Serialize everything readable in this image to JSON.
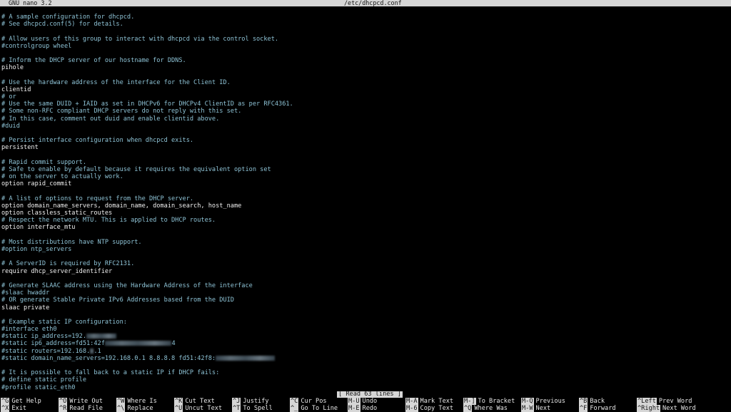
{
  "titlebar": {
    "app": "GNU nano 3.2",
    "file": "/etc/dhcpcd.conf"
  },
  "lines": [
    {
      "t": "# A sample configuration for dhcpcd.",
      "k": "comment"
    },
    {
      "t": "# See dhcpcd.conf(5) for details.",
      "k": "comment"
    },
    {
      "t": "",
      "k": "blank"
    },
    {
      "t": "# Allow users of this group to interact with dhcpcd via the control socket.",
      "k": "comment"
    },
    {
      "t": "#controlgroup wheel",
      "k": "comment"
    },
    {
      "t": "",
      "k": "blank"
    },
    {
      "t": "# Inform the DHCP server of our hostname for DDNS.",
      "k": "comment"
    },
    {
      "t": "pihole",
      "k": "code"
    },
    {
      "t": "",
      "k": "blank"
    },
    {
      "t": "# Use the hardware address of the interface for the Client ID.",
      "k": "comment"
    },
    {
      "t": "clientid",
      "k": "code"
    },
    {
      "t": "# or",
      "k": "comment"
    },
    {
      "t": "# Use the same DUID + IAID as set in DHCPv6 for DHCPv4 ClientID as per RFC4361.",
      "k": "comment"
    },
    {
      "t": "# Some non-RFC compliant DHCP servers do not reply with this set.",
      "k": "comment"
    },
    {
      "t": "# In this case, comment out duid and enable clientid above.",
      "k": "comment"
    },
    {
      "t": "#duid",
      "k": "comment"
    },
    {
      "t": "",
      "k": "blank"
    },
    {
      "t": "# Persist interface configuration when dhcpcd exits.",
      "k": "comment"
    },
    {
      "t": "persistent",
      "k": "code"
    },
    {
      "t": "",
      "k": "blank"
    },
    {
      "t": "# Rapid commit support.",
      "k": "comment"
    },
    {
      "t": "# Safe to enable by default because it requires the equivalent option set",
      "k": "comment"
    },
    {
      "t": "# on the server to actually work.",
      "k": "comment"
    },
    {
      "t": "option rapid_commit",
      "k": "code"
    },
    {
      "t": "",
      "k": "blank"
    },
    {
      "t": "# A list of options to request from the DHCP server.",
      "k": "comment"
    },
    {
      "t": "option domain_name_servers, domain_name, domain_search, host_name",
      "k": "code"
    },
    {
      "t": "option classless_static_routes",
      "k": "code"
    },
    {
      "t": "# Respect the network MTU. This is applied to DHCP routes.",
      "k": "comment"
    },
    {
      "t": "option interface_mtu",
      "k": "code"
    },
    {
      "t": "",
      "k": "blank"
    },
    {
      "t": "# Most distributions have NTP support.",
      "k": "comment"
    },
    {
      "t": "#option ntp_servers",
      "k": "comment"
    },
    {
      "t": "",
      "k": "blank"
    },
    {
      "t": "# A ServerID is required by RFC2131.",
      "k": "comment"
    },
    {
      "t": "require dhcp_server_identifier",
      "k": "code"
    },
    {
      "t": "",
      "k": "blank"
    },
    {
      "t": "# Generate SLAAC address using the Hardware Address of the interface",
      "k": "comment"
    },
    {
      "t": "#slaac hwaddr",
      "k": "comment"
    },
    {
      "t": "# OR generate Stable Private IPv6 Addresses based from the DUID",
      "k": "comment"
    },
    {
      "t": "slaac private",
      "k": "code"
    },
    {
      "t": "",
      "k": "blank"
    },
    {
      "t": "# Example static IP configuration:",
      "k": "comment"
    },
    {
      "t": "#interface eth0",
      "k": "comment"
    },
    {
      "t": "#static ip_address=192.",
      "k": "comment",
      "redacted": 8
    },
    {
      "t": "#static ip6_address=fd51:42f",
      "k": "comment",
      "redacted": 18,
      "tail": "4"
    },
    {
      "t": "#static routers=192.168.",
      "k": "comment",
      "tail": ".1",
      "redacted": 1
    },
    {
      "t": "#static domain_name_servers=192.168.0.1 8.8.8.8 fd51:42f8:",
      "k": "comment",
      "redacted": 16
    },
    {
      "t": "",
      "k": "blank"
    },
    {
      "t": "# It is possible to fall back to a static IP if DHCP fails:",
      "k": "comment"
    },
    {
      "t": "# define static profile",
      "k": "comment"
    },
    {
      "t": "#profile static_eth0",
      "k": "comment"
    }
  ],
  "status": "[ Read 63 lines ]",
  "shortcuts": [
    {
      "key": "^G",
      "label": "Get Help",
      "name": "get-help"
    },
    {
      "key": "^X",
      "label": "Exit",
      "name": "exit"
    },
    {
      "key": "^O",
      "label": "Write Out",
      "name": "write-out"
    },
    {
      "key": "^R",
      "label": "Read File",
      "name": "read-file"
    },
    {
      "key": "^W",
      "label": "Where Is",
      "name": "where-is"
    },
    {
      "key": "^\\",
      "label": "Replace",
      "name": "replace"
    },
    {
      "key": "^K",
      "label": "Cut Text",
      "name": "cut-text"
    },
    {
      "key": "^U",
      "label": "Uncut Text",
      "name": "uncut-text"
    },
    {
      "key": "^J",
      "label": "Justify",
      "name": "justify"
    },
    {
      "key": "^T",
      "label": "To Spell",
      "name": "to-spell"
    },
    {
      "key": "^C",
      "label": "Cur Pos",
      "name": "cur-pos"
    },
    {
      "key": "^_",
      "label": "Go To Line",
      "name": "go-to-line"
    },
    {
      "key": "M-U",
      "label": "Undo",
      "name": "undo"
    },
    {
      "key": "M-E",
      "label": "Redo",
      "name": "redo"
    },
    {
      "key": "M-A",
      "label": "Mark Text",
      "name": "mark-text"
    },
    {
      "key": "M-6",
      "label": "Copy Text",
      "name": "copy-text"
    },
    {
      "key": "M-]",
      "label": "To Bracket",
      "name": "to-bracket"
    },
    {
      "key": "^Q",
      "label": "Where Was",
      "name": "where-was"
    },
    {
      "key": "M-Q",
      "label": "Previous",
      "name": "previous"
    },
    {
      "key": "M-W",
      "label": "Next",
      "name": "next"
    },
    {
      "key": "^B",
      "label": "Back",
      "name": "back"
    },
    {
      "key": "^F",
      "label": "Forward",
      "name": "forward"
    },
    {
      "key": "^Left",
      "label": "Prev Word",
      "name": "prev-word"
    },
    {
      "key": "^Right",
      "label": "Next Word",
      "name": "next-word"
    }
  ]
}
